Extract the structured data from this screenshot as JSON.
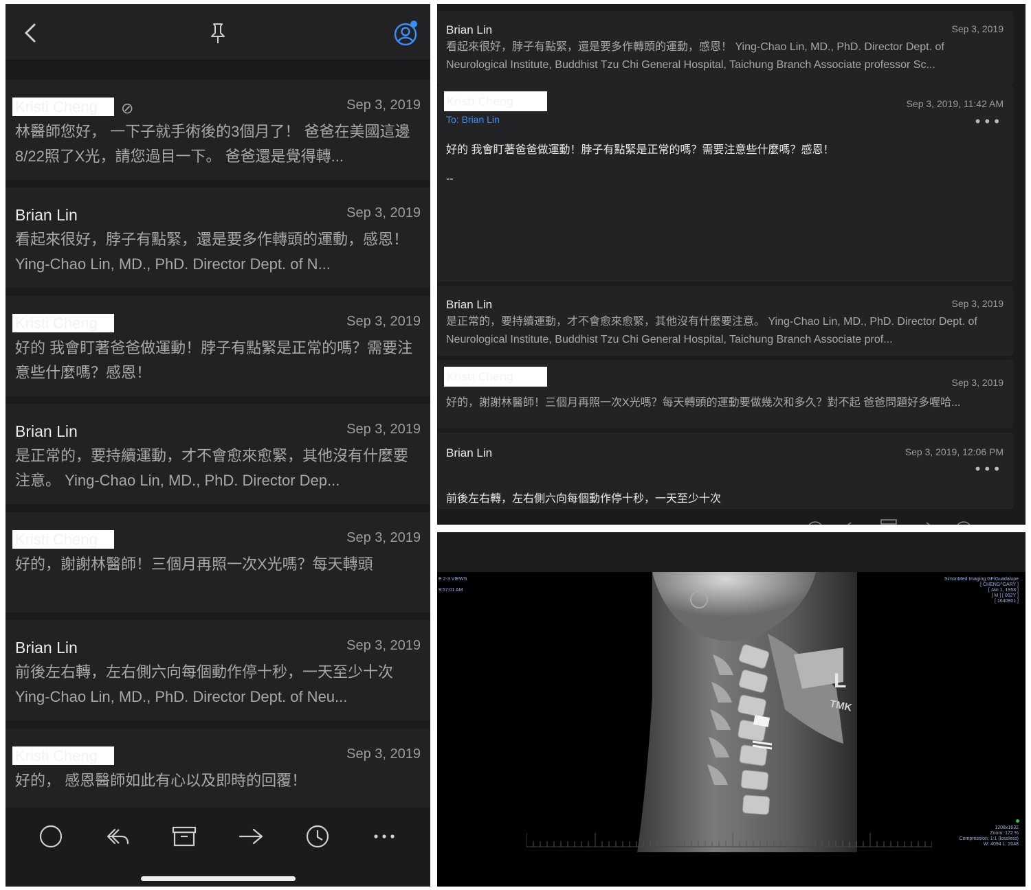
{
  "mail_list": {
    "items": [
      {
        "sender": "Kristi Cheng",
        "redacted": true,
        "has_attachment": true,
        "date": "Sep 3, 2019",
        "preview": "林醫師您好， 一下子就手術後的3個月了！ 爸爸在美國這邊8/22照了X光，請您過目一下。 爸爸還是覺得轉..."
      },
      {
        "sender": "Brian Lin",
        "redacted": false,
        "has_attachment": false,
        "date": "Sep 3, 2019",
        "preview": "看起來很好，脖子有點緊，還是要多作轉頭的運動，感恩！ Ying-Chao Lin, MD., PhD. Director Dept. of N..."
      },
      {
        "sender": "Kristi Cheng",
        "redacted": true,
        "has_attachment": false,
        "date": "Sep 3, 2019",
        "preview": "好的 我會盯著爸爸做運動！脖子有點緊是正常的嗎？需要注意些什麼嗎？感恩！"
      },
      {
        "sender": "Brian Lin",
        "redacted": false,
        "has_attachment": false,
        "date": "Sep 3, 2019",
        "preview": "是正常的，要持續運動，才不會愈來愈緊，其他沒有什麼要注意。 Ying-Chao Lin, MD., PhD. Director Dep..."
      },
      {
        "sender": "Kristi Cheng",
        "redacted": true,
        "has_attachment": false,
        "date": "Sep 3, 2019",
        "preview": "好的，謝謝林醫師！三個月再照一次X光嗎？每天轉頭"
      },
      {
        "sender": "Brian Lin",
        "redacted": false,
        "has_attachment": false,
        "date": "Sep 3, 2019",
        "preview": "前後左右轉，左右側六向每個動作停十秒，一天至少十次 Ying-Chao Lin, MD., PhD. Director Dept. of Neu..."
      },
      {
        "sender": "Kristi Cheng",
        "redacted": true,
        "has_attachment": false,
        "date": "Sep 3, 2019",
        "preview": "好的， 感恩醫師如此有心以及即時的回覆！"
      }
    ]
  },
  "topbar_icons": [
    "back-icon",
    "pin-icon",
    "account-icon"
  ],
  "toolbar_icons": [
    "mark-circle-icon",
    "reply-icon",
    "archive-icon",
    "forward-icon",
    "snooze-clock-icon",
    "more-icon"
  ],
  "thread": {
    "msg1": {
      "sender": "Brian Lin",
      "date": "Sep 3, 2019",
      "preview": "看起來很好，脖子有點緊，還是要多作轉頭的運動，感恩！ Ying-Chao Lin, MD., PhD. Director Dept. of Neurological Institute, Buddhist Tzu Chi General Hospital, Taichung Branch Associate professor Sc..."
    },
    "msg2": {
      "sender": "Kristi Cheng",
      "date": "Sep 3, 2019, 11:42 AM",
      "to": "To: Brian Lin",
      "more": "•••",
      "body": "好的 我會盯著爸爸做運動！脖子有點緊是正常的嗎？需要注意些什麼嗎？感恩！",
      "signature": "--"
    },
    "msg3": {
      "sender": "Brian Lin",
      "date": "Sep 3, 2019",
      "preview": "是正常的，要持續運動，才不會愈來愈緊，其他沒有什麼要注意。 Ying-Chao Lin, MD., PhD. Director Dept. of Neurological Institute, Buddhist Tzu Chi General Hospital, Taichung Branch Associate prof..."
    },
    "msg4": {
      "sender": "Kristi Cheng",
      "date": "Sep 3, 2019",
      "preview": "好的，謝謝林醫師！三個月再照一次X光嗎？每天轉頭的運動要做幾次和多久？對不起 爸爸問題好多喔哈..."
    },
    "msg5": {
      "sender": "Brian Lin",
      "date": "Sep 3, 2019, 12:06 PM",
      "more": "•••",
      "body": "前後左右轉，左右側六向每個動作停十秒，一天至少十次"
    }
  },
  "xray": {
    "left_meta": [
      "E 2-3 VIEWS",
      "9:57:01 AM"
    ],
    "right_meta": [
      "SimonMed Imaging GF/Guadalupe",
      "[ CHENG^GARY ]",
      "[ Jan 1, 1958 ]",
      "[ M ] [ 062Y ]",
      "[ 1640901 ]"
    ],
    "bottom_meta": [
      "1208x1632",
      "Zoom: 172 %",
      "Compression: 1:1 (lossless)",
      "W: 4094 L: 2048"
    ],
    "marker_L": "L",
    "marker_TMK": "TMK"
  }
}
